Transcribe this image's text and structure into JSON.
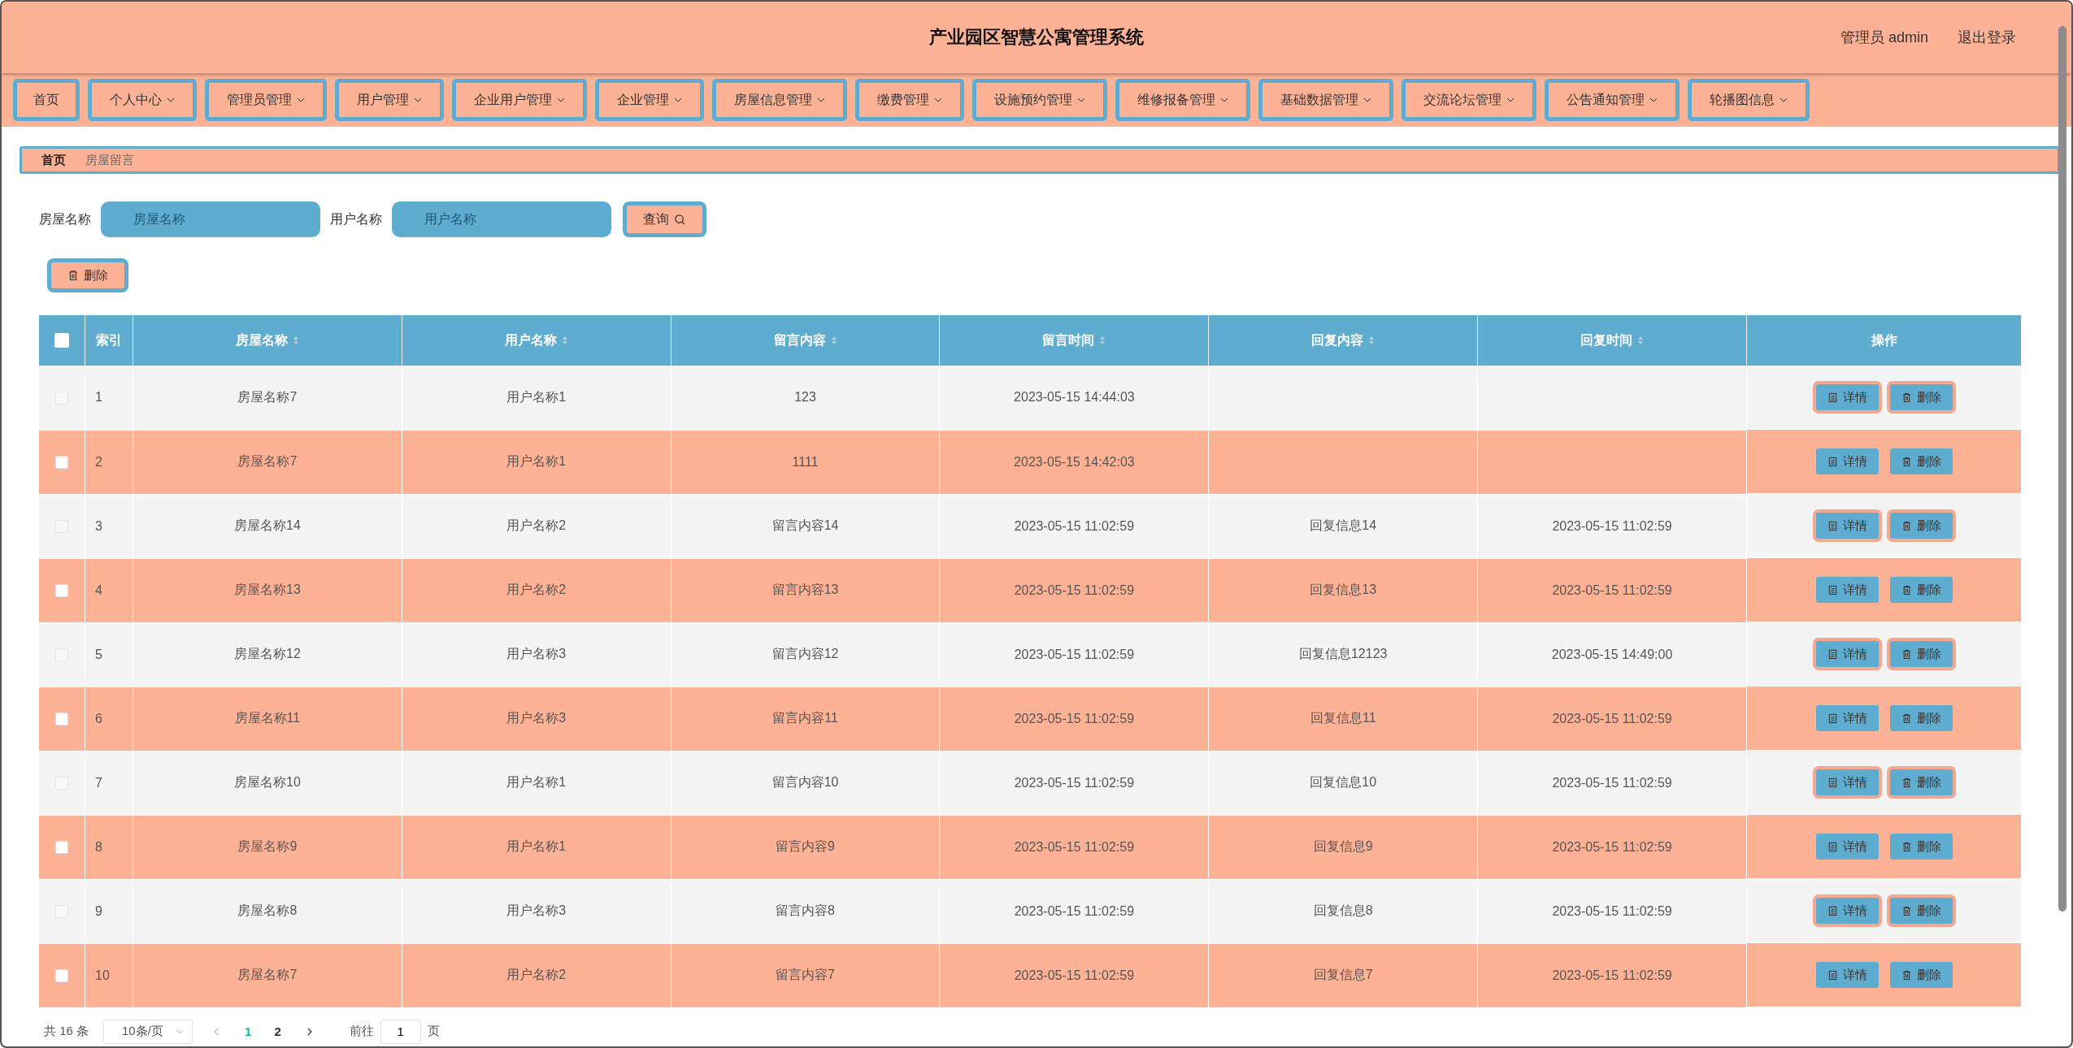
{
  "header": {
    "title": "产业园区智慧公寓管理系统",
    "user": "管理员 admin",
    "logout": "退出登录"
  },
  "nav": [
    {
      "label": "首页",
      "dropdown": false
    },
    {
      "label": "个人中心",
      "dropdown": true
    },
    {
      "label": "管理员管理",
      "dropdown": true
    },
    {
      "label": "用户管理",
      "dropdown": true
    },
    {
      "label": "企业用户管理",
      "dropdown": true
    },
    {
      "label": "企业管理",
      "dropdown": true
    },
    {
      "label": "房屋信息管理",
      "dropdown": true
    },
    {
      "label": "缴费管理",
      "dropdown": true
    },
    {
      "label": "设施预约管理",
      "dropdown": true
    },
    {
      "label": "维修报备管理",
      "dropdown": true
    },
    {
      "label": "基础数据管理",
      "dropdown": true
    },
    {
      "label": "交流论坛管理",
      "dropdown": true
    },
    {
      "label": "公告通知管理",
      "dropdown": true
    },
    {
      "label": "轮播图信息",
      "dropdown": true
    }
  ],
  "breadcrumb": [
    "首页",
    "房屋留言"
  ],
  "search": {
    "fields": [
      {
        "label": "房屋名称",
        "placeholder": "房屋名称"
      },
      {
        "label": "用户名称",
        "placeholder": "用户名称"
      }
    ],
    "button": "查询"
  },
  "delete_button": "删除",
  "table": {
    "select_all": false,
    "columns": [
      {
        "label": "索引",
        "sortable": false
      },
      {
        "label": "房屋名称",
        "sortable": true
      },
      {
        "label": "用户名称",
        "sortable": true
      },
      {
        "label": "留言内容",
        "sortable": true
      },
      {
        "label": "留言时间",
        "sortable": true
      },
      {
        "label": "回复内容",
        "sortable": true
      },
      {
        "label": "回复时间",
        "sortable": true
      },
      {
        "label": "操作",
        "sortable": false
      }
    ],
    "rows": [
      {
        "checked": false,
        "cells": [
          "1",
          "房屋名称7",
          "用户名称1",
          "123",
          "2023-05-15 14:44:03",
          "",
          ""
        ],
        "actions": [
          "详情",
          "删除"
        ]
      },
      {
        "checked": false,
        "cells": [
          "2",
          "房屋名称7",
          "用户名称1",
          "1111",
          "2023-05-15 14:42:03",
          "",
          ""
        ],
        "actions": [
          "详情",
          "删除"
        ]
      },
      {
        "checked": false,
        "cells": [
          "3",
          "房屋名称14",
          "用户名称2",
          "留言内容14",
          "2023-05-15 11:02:59",
          "回复信息14",
          "2023-05-15 11:02:59"
        ],
        "actions": [
          "详情",
          "删除"
        ]
      },
      {
        "checked": false,
        "cells": [
          "4",
          "房屋名称13",
          "用户名称2",
          "留言内容13",
          "2023-05-15 11:02:59",
          "回复信息13",
          "2023-05-15 11:02:59"
        ],
        "actions": [
          "详情",
          "删除"
        ]
      },
      {
        "checked": false,
        "cells": [
          "5",
          "房屋名称12",
          "用户名称3",
          "留言内容12",
          "2023-05-15 11:02:59",
          "回复信息12123",
          "2023-05-15 14:49:00"
        ],
        "actions": [
          "详情",
          "删除"
        ]
      },
      {
        "checked": false,
        "cells": [
          "6",
          "房屋名称11",
          "用户名称3",
          "留言内容11",
          "2023-05-15 11:02:59",
          "回复信息11",
          "2023-05-15 11:02:59"
        ],
        "actions": [
          "详情",
          "删除"
        ]
      },
      {
        "checked": false,
        "cells": [
          "7",
          "房屋名称10",
          "用户名称1",
          "留言内容10",
          "2023-05-15 11:02:59",
          "回复信息10",
          "2023-05-15 11:02:59"
        ],
        "actions": [
          "详情",
          "删除"
        ]
      },
      {
        "checked": false,
        "cells": [
          "8",
          "房屋名称9",
          "用户名称1",
          "留言内容9",
          "2023-05-15 11:02:59",
          "回复信息9",
          "2023-05-15 11:02:59"
        ],
        "actions": [
          "详情",
          "删除"
        ]
      },
      {
        "checked": false,
        "cells": [
          "9",
          "房屋名称8",
          "用户名称3",
          "留言内容8",
          "2023-05-15 11:02:59",
          "回复信息8",
          "2023-05-15 11:02:59"
        ],
        "actions": [
          "详情",
          "删除"
        ]
      },
      {
        "checked": false,
        "cells": [
          "10",
          "房屋名称7",
          "用户名称2",
          "留言内容7",
          "2023-05-15 11:02:59",
          "回复信息7",
          "2023-05-15 11:02:59"
        ],
        "actions": [
          "详情",
          "删除"
        ]
      }
    ]
  },
  "pagination": {
    "total": "共 16 条",
    "page_size": "10条/页",
    "pages": [
      {
        "label": "1",
        "selected": true
      },
      {
        "label": "2",
        "selected": false
      }
    ],
    "goto_label": "前往",
    "goto_value": "1",
    "goto_suffix": "页"
  }
}
